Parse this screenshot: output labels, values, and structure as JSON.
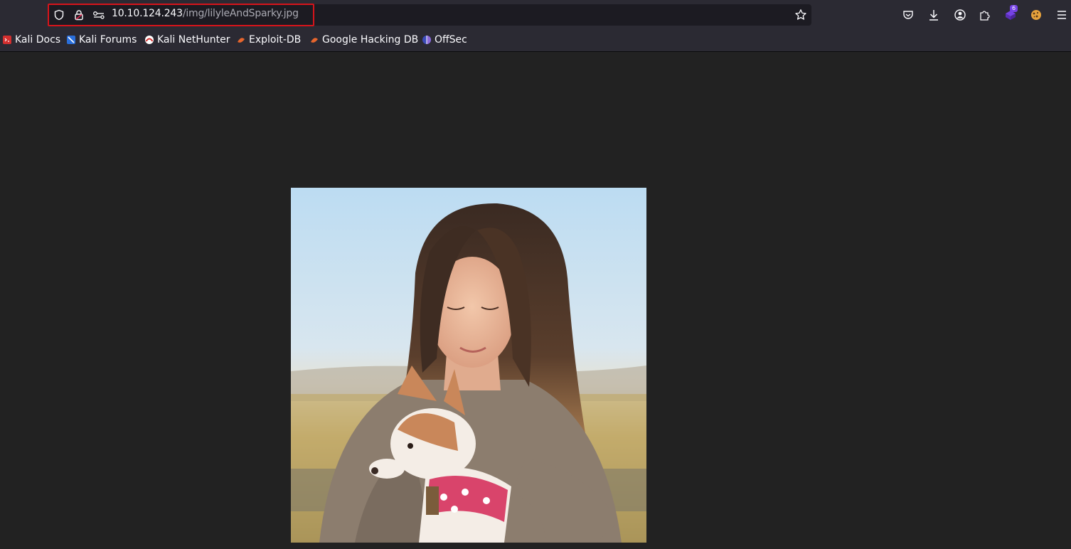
{
  "browser": {
    "url_host": "10.10.124.243",
    "url_path": "/img/lilyleAndSparky.jpg",
    "extensions_badge": "6",
    "icons": {
      "shield": "shield-icon",
      "lock": "lock-icon",
      "permissions": "key-icon",
      "star": "star-icon",
      "pocket": "pocket-icon",
      "downloads": "download-icon",
      "account": "account-icon",
      "extensions": "puzzle-icon",
      "menu": "hamburger-menu-icon"
    },
    "colors": {
      "highlight_border": "#d7141b",
      "toolbar": "#2b2a33",
      "page_bg": "#222222"
    }
  },
  "bookmarks": [
    {
      "label": "Kali Docs",
      "icon": "kali-docs-icon"
    },
    {
      "label": "Kali Forums",
      "icon": "kali-forums-icon"
    },
    {
      "label": "Kali NetHunter",
      "icon": "kali-nethunter-icon"
    },
    {
      "label": "Exploit-DB",
      "icon": "exploit-db-icon"
    },
    {
      "label": "Google Hacking DB",
      "icon": "ghdb-icon"
    },
    {
      "label": "OffSec",
      "icon": "offsec-icon"
    }
  ],
  "image": {
    "subject": "photo",
    "icon": "woman-with-dog-photo"
  }
}
